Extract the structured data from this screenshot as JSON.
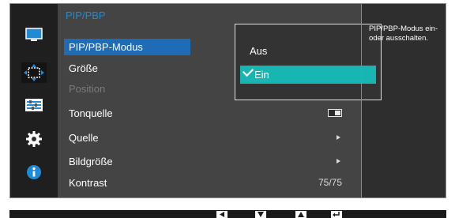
{
  "menu": {
    "title": "PIP/PBP",
    "items": [
      {
        "label": "PIP/PBP-Modus",
        "state": "selected"
      },
      {
        "label": "Größe",
        "state": "normal"
      },
      {
        "label": "Position",
        "state": "disabled"
      },
      {
        "label": "Tonquelle",
        "state": "normal",
        "control": "toggle"
      },
      {
        "label": "Quelle",
        "state": "normal",
        "control": "arrow"
      },
      {
        "label": "Bildgröße",
        "state": "normal",
        "control": "arrow"
      },
      {
        "label": "Kontrast",
        "state": "normal",
        "value": "75/75"
      }
    ]
  },
  "submenu": {
    "options": [
      {
        "label": "Aus",
        "selected": false
      },
      {
        "label": "Ein",
        "selected": true
      }
    ],
    "highlight_color": "#17b6b3"
  },
  "help": {
    "text": "PIP/PBP-Modus ein- oder ausschalten."
  },
  "sidebar": {
    "icons": [
      {
        "name": "monitor-icon",
        "active": false
      },
      {
        "name": "pip-arrows-icon",
        "active": true
      },
      {
        "name": "settings-bars-icon",
        "active": false
      },
      {
        "name": "gear-icon",
        "active": false
      },
      {
        "name": "info-icon",
        "active": false
      }
    ]
  },
  "bottom_bar": {
    "keys": [
      "left-arrow-key-icon",
      "down-arrow-key-icon",
      "up-arrow-key-icon",
      "enter-key-icon"
    ]
  },
  "colors": {
    "selected_item": "#1f6bb5",
    "title": "#1f8ad6",
    "panel": "#444444"
  }
}
